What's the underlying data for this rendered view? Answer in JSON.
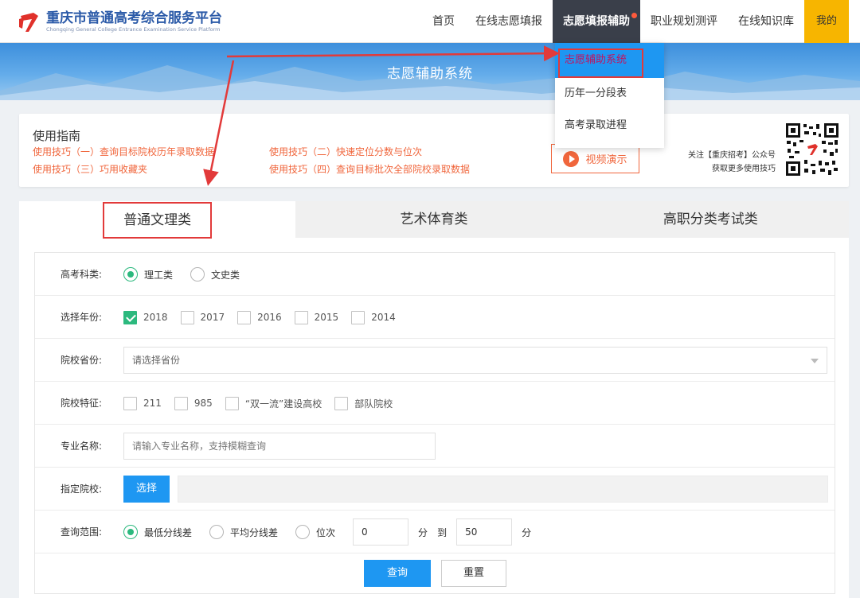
{
  "header": {
    "logo_title": "重庆市普通高考综合服务平台",
    "logo_subtitle": "Chongqing General College Entrance Examination Service Platform",
    "nav": [
      {
        "label": "首页"
      },
      {
        "label": "在线志愿填报"
      },
      {
        "label": "志愿填报辅助"
      },
      {
        "label": "职业规划测评"
      },
      {
        "label": "在线知识库"
      },
      {
        "label": "我的"
      }
    ]
  },
  "banner": {
    "title": "志愿辅助系统"
  },
  "dropdown": {
    "items": [
      {
        "label": "志愿辅助系统"
      },
      {
        "label": "历年一分段表"
      },
      {
        "label": "高考录取进程"
      }
    ]
  },
  "guide": {
    "title": "使用指南",
    "tips": [
      "使用技巧（一）查询目标院校历年录取数据",
      "使用技巧（二）快速定位分数与位次",
      "使用技巧（三）巧用收藏夹",
      "使用技巧（四）查询目标批次全部院校录取数据"
    ],
    "video_label": "视频演示",
    "follow_line1": "关注【重庆招考】公众号",
    "follow_line2": "获取更多使用技巧"
  },
  "tabs": [
    {
      "label": "普通文理类"
    },
    {
      "label": "艺术体育类"
    },
    {
      "label": "高职分类考试类"
    }
  ],
  "form": {
    "subject": {
      "label": "高考科类:",
      "options": [
        {
          "label": "理工类",
          "checked": true
        },
        {
          "label": "文史类",
          "checked": false
        }
      ]
    },
    "year": {
      "label": "选择年份:",
      "options": [
        {
          "label": "2018",
          "checked": true
        },
        {
          "label": "2017",
          "checked": false
        },
        {
          "label": "2016",
          "checked": false
        },
        {
          "label": "2015",
          "checked": false
        },
        {
          "label": "2014",
          "checked": false
        }
      ]
    },
    "province": {
      "label": "院校省份:",
      "placeholder": "请选择省份"
    },
    "feature": {
      "label": "院校特征:",
      "options": [
        {
          "label": "211",
          "checked": false
        },
        {
          "label": "985",
          "checked": false
        },
        {
          "label": "“双一流”建设高校",
          "checked": false
        },
        {
          "label": "部队院校",
          "checked": false
        }
      ]
    },
    "major": {
      "label": "专业名称:",
      "placeholder": "请输入专业名称，支持模糊查询"
    },
    "school": {
      "label": "指定院校:",
      "button": "选择"
    },
    "range": {
      "label": "查询范围:",
      "options": [
        {
          "label": "最低分线差",
          "checked": true
        },
        {
          "label": "平均分线差",
          "checked": false
        },
        {
          "label": "位次",
          "checked": false
        }
      ],
      "from": "0",
      "unit": "分",
      "to_label": "到",
      "to": "50"
    },
    "query_button": "查询",
    "reset_button": "重置"
  },
  "colors": {
    "accent_blue": "#1e97f2",
    "brand_orange": "#f0663c",
    "check_green": "#2cb97e",
    "nav_active": "#3a3f4a",
    "mine_yellow": "#f7b500",
    "annotation_red": "#e23a3a"
  }
}
